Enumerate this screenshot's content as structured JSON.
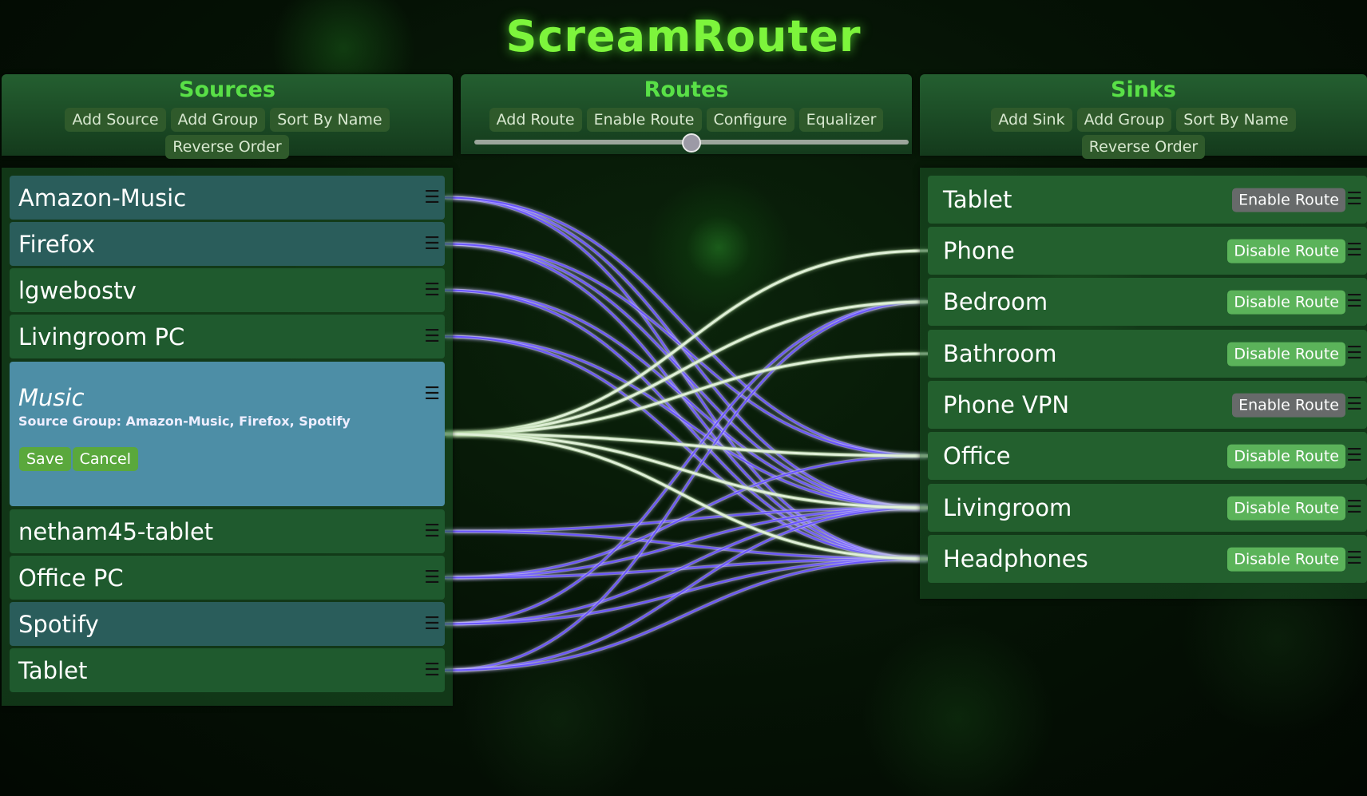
{
  "app": {
    "title": "ScreamRouter"
  },
  "sources": {
    "title": "Sources",
    "buttons": [
      "Add Source",
      "Add Group",
      "Sort By Name",
      "Reverse Order"
    ],
    "items": [
      {
        "name": "Amazon-Music",
        "style": "blue"
      },
      {
        "name": "Firefox",
        "style": "blue"
      },
      {
        "name": "lgwebostv",
        "style": "green"
      },
      {
        "name": "Livingroom PC",
        "style": "green"
      },
      {
        "name": "Music",
        "style": "expanded",
        "group_info": "Source Group: Amazon-Music, Firefox, Spotify",
        "save_label": "Save",
        "cancel_label": "Cancel"
      },
      {
        "name": "netham45-tablet",
        "style": "green"
      },
      {
        "name": "Office PC",
        "style": "green"
      },
      {
        "name": "Spotify",
        "style": "blue"
      },
      {
        "name": "Tablet",
        "style": "green"
      }
    ]
  },
  "routes": {
    "title": "Routes",
    "buttons": [
      "Add Route",
      "Enable Route",
      "Configure",
      "Equalizer"
    ],
    "slider_value": 0.5
  },
  "sinks": {
    "title": "Sinks",
    "buttons": [
      "Add Sink",
      "Add Group",
      "Sort By Name",
      "Reverse Order"
    ],
    "items": [
      {
        "name": "Tablet",
        "route_label": "Enable Route",
        "route_state": "enable"
      },
      {
        "name": "Phone",
        "route_label": "Disable Route",
        "route_state": "disable"
      },
      {
        "name": "Bedroom",
        "route_label": "Disable Route",
        "route_state": "disable"
      },
      {
        "name": "Bathroom",
        "route_label": "Disable Route",
        "route_state": "disable"
      },
      {
        "name": "Phone VPN",
        "route_label": "Enable Route",
        "route_state": "enable"
      },
      {
        "name": "Office",
        "route_label": "Disable Route",
        "route_state": "disable"
      },
      {
        "name": "Livingroom",
        "route_label": "Disable Route",
        "route_state": "disable"
      },
      {
        "name": "Headphones",
        "route_label": "Disable Route",
        "route_state": "disable"
      }
    ]
  },
  "connections": {
    "highlighted_source": "Music",
    "colors": {
      "normal": "#6a55ff",
      "highlight": "#e0f0d8"
    },
    "links": [
      [
        "Amazon-Music",
        "Livingroom"
      ],
      [
        "Amazon-Music",
        "Headphones"
      ],
      [
        "Amazon-Music",
        "Office"
      ],
      [
        "Firefox",
        "Livingroom"
      ],
      [
        "Firefox",
        "Headphones"
      ],
      [
        "Firefox",
        "Office"
      ],
      [
        "lgwebostv",
        "Livingroom"
      ],
      [
        "lgwebostv",
        "Headphones"
      ],
      [
        "Livingroom PC",
        "Livingroom"
      ],
      [
        "Livingroom PC",
        "Headphones"
      ],
      [
        "Music",
        "Phone"
      ],
      [
        "Music",
        "Bedroom"
      ],
      [
        "Music",
        "Bathroom"
      ],
      [
        "Music",
        "Office"
      ],
      [
        "Music",
        "Livingroom"
      ],
      [
        "Music",
        "Headphones"
      ],
      [
        "netham45-tablet",
        "Livingroom"
      ],
      [
        "netham45-tablet",
        "Headphones"
      ],
      [
        "Office PC",
        "Office"
      ],
      [
        "Office PC",
        "Livingroom"
      ],
      [
        "Office PC",
        "Headphones"
      ],
      [
        "Spotify",
        "Bedroom"
      ],
      [
        "Spotify",
        "Livingroom"
      ],
      [
        "Spotify",
        "Headphones"
      ],
      [
        "Tablet",
        "Bedroom"
      ],
      [
        "Tablet",
        "Livingroom"
      ],
      [
        "Tablet",
        "Headphones"
      ]
    ]
  }
}
